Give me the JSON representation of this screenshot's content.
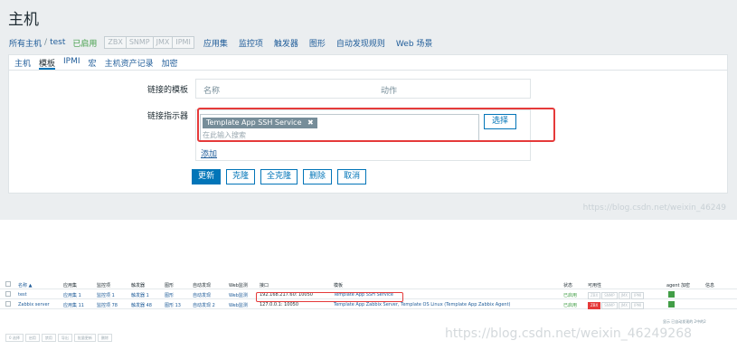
{
  "page_title": "主机",
  "breadcrumb": {
    "all_hosts": "所有主机",
    "separator": "/",
    "host": "test",
    "status": "已启用",
    "availability": [
      "ZBX",
      "SNMP",
      "JMX",
      "IPMI"
    ],
    "nav": [
      "应用集",
      "监控项",
      "触发器",
      "图形",
      "自动发现规则",
      "Web 场景"
    ]
  },
  "tabs": [
    "主机",
    "模板",
    "IPMI",
    "宏",
    "主机资产记录",
    "加密"
  ],
  "form": {
    "linked_templates_label": "链接的模板",
    "col_name": "名称",
    "col_action": "动作",
    "link_indicator_label": "链接指示器",
    "chip_label": "Template App SSH Service",
    "chip_remove": "✖",
    "search_placeholder": "在此输入搜索",
    "select_button": "选择",
    "add_link": "添加"
  },
  "buttons": [
    "更新",
    "克隆",
    "全克隆",
    "删除",
    "取消"
  ],
  "watermark_top": "https://blog.csdn.net/weixin_46249",
  "list": {
    "headers": [
      "名称 ▲",
      "应用集",
      "监控项",
      "触发器",
      "图形",
      "自动发现",
      "Web监测",
      "接口",
      "模板",
      "状态",
      "可用性",
      "agent 加密",
      "信息"
    ],
    "rows": [
      {
        "name": "test",
        "apps": "应用集 1",
        "items": "监控项 1",
        "triggers": "触发器 1",
        "graphs": "图形",
        "discovery": "自动发现",
        "web": "Web监测",
        "interface": "192.168.217.60: 10050",
        "templates": "Template App SSH Service",
        "status": "已启用",
        "availability": [
          "ZBX",
          "SNMP",
          "JMX",
          "IPMI"
        ],
        "zbx_red": false
      },
      {
        "name": "Zabbix server",
        "apps": "应用集 11",
        "items": "监控项 78",
        "triggers": "触发器 48",
        "graphs": "图形 13",
        "discovery": "自动发现 2",
        "web": "Web监测",
        "interface": "127.0.0.1: 10050",
        "templates": "Template App Zabbix Server, Template OS Linux (Template App Zabbix Agent)",
        "status": "已启用",
        "availability": [
          "ZBX",
          "SNMP",
          "JMX",
          "IPMI"
        ],
        "zbx_red": true
      }
    ],
    "count_text": "显示 已自动发现的 2中的2",
    "footer_buttons": [
      "0 选择",
      "启用",
      "禁用",
      "导出",
      "批量更新",
      "删除"
    ]
  },
  "watermark_bottom": "https://blog.csdn.net/weixin_46249268",
  "colors": {
    "accent": "#0275b8",
    "link": "#1f5c99",
    "enabled": "#429e47",
    "highlight": "#e53a3a"
  }
}
